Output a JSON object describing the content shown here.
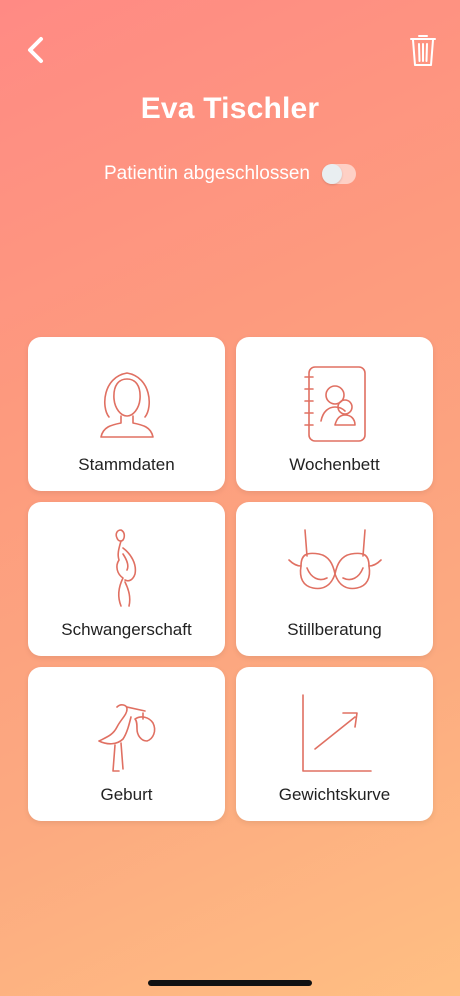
{
  "header": {
    "title": "Eva Tischler",
    "back_icon": "chevron-left-icon",
    "trash_icon": "trash-icon"
  },
  "patient_status": {
    "label": "Patientin abgeschlossen",
    "toggle_on": false
  },
  "tiles": [
    {
      "label": "Stammdaten",
      "icon": "person-bust-icon"
    },
    {
      "label": "Wochenbett",
      "icon": "address-book-baby-icon"
    },
    {
      "label": "Schwangerschaft",
      "icon": "pregnant-woman-icon"
    },
    {
      "label": "Stillberatung",
      "icon": "nursing-bra-icon"
    },
    {
      "label": "Geburt",
      "icon": "stork-icon"
    },
    {
      "label": "Gewichtskurve",
      "icon": "growth-chart-icon"
    }
  ],
  "colors": {
    "accent_icon": "#e07062",
    "gradient_start": "#ff8a84",
    "gradient_end": "#ffbf83"
  }
}
